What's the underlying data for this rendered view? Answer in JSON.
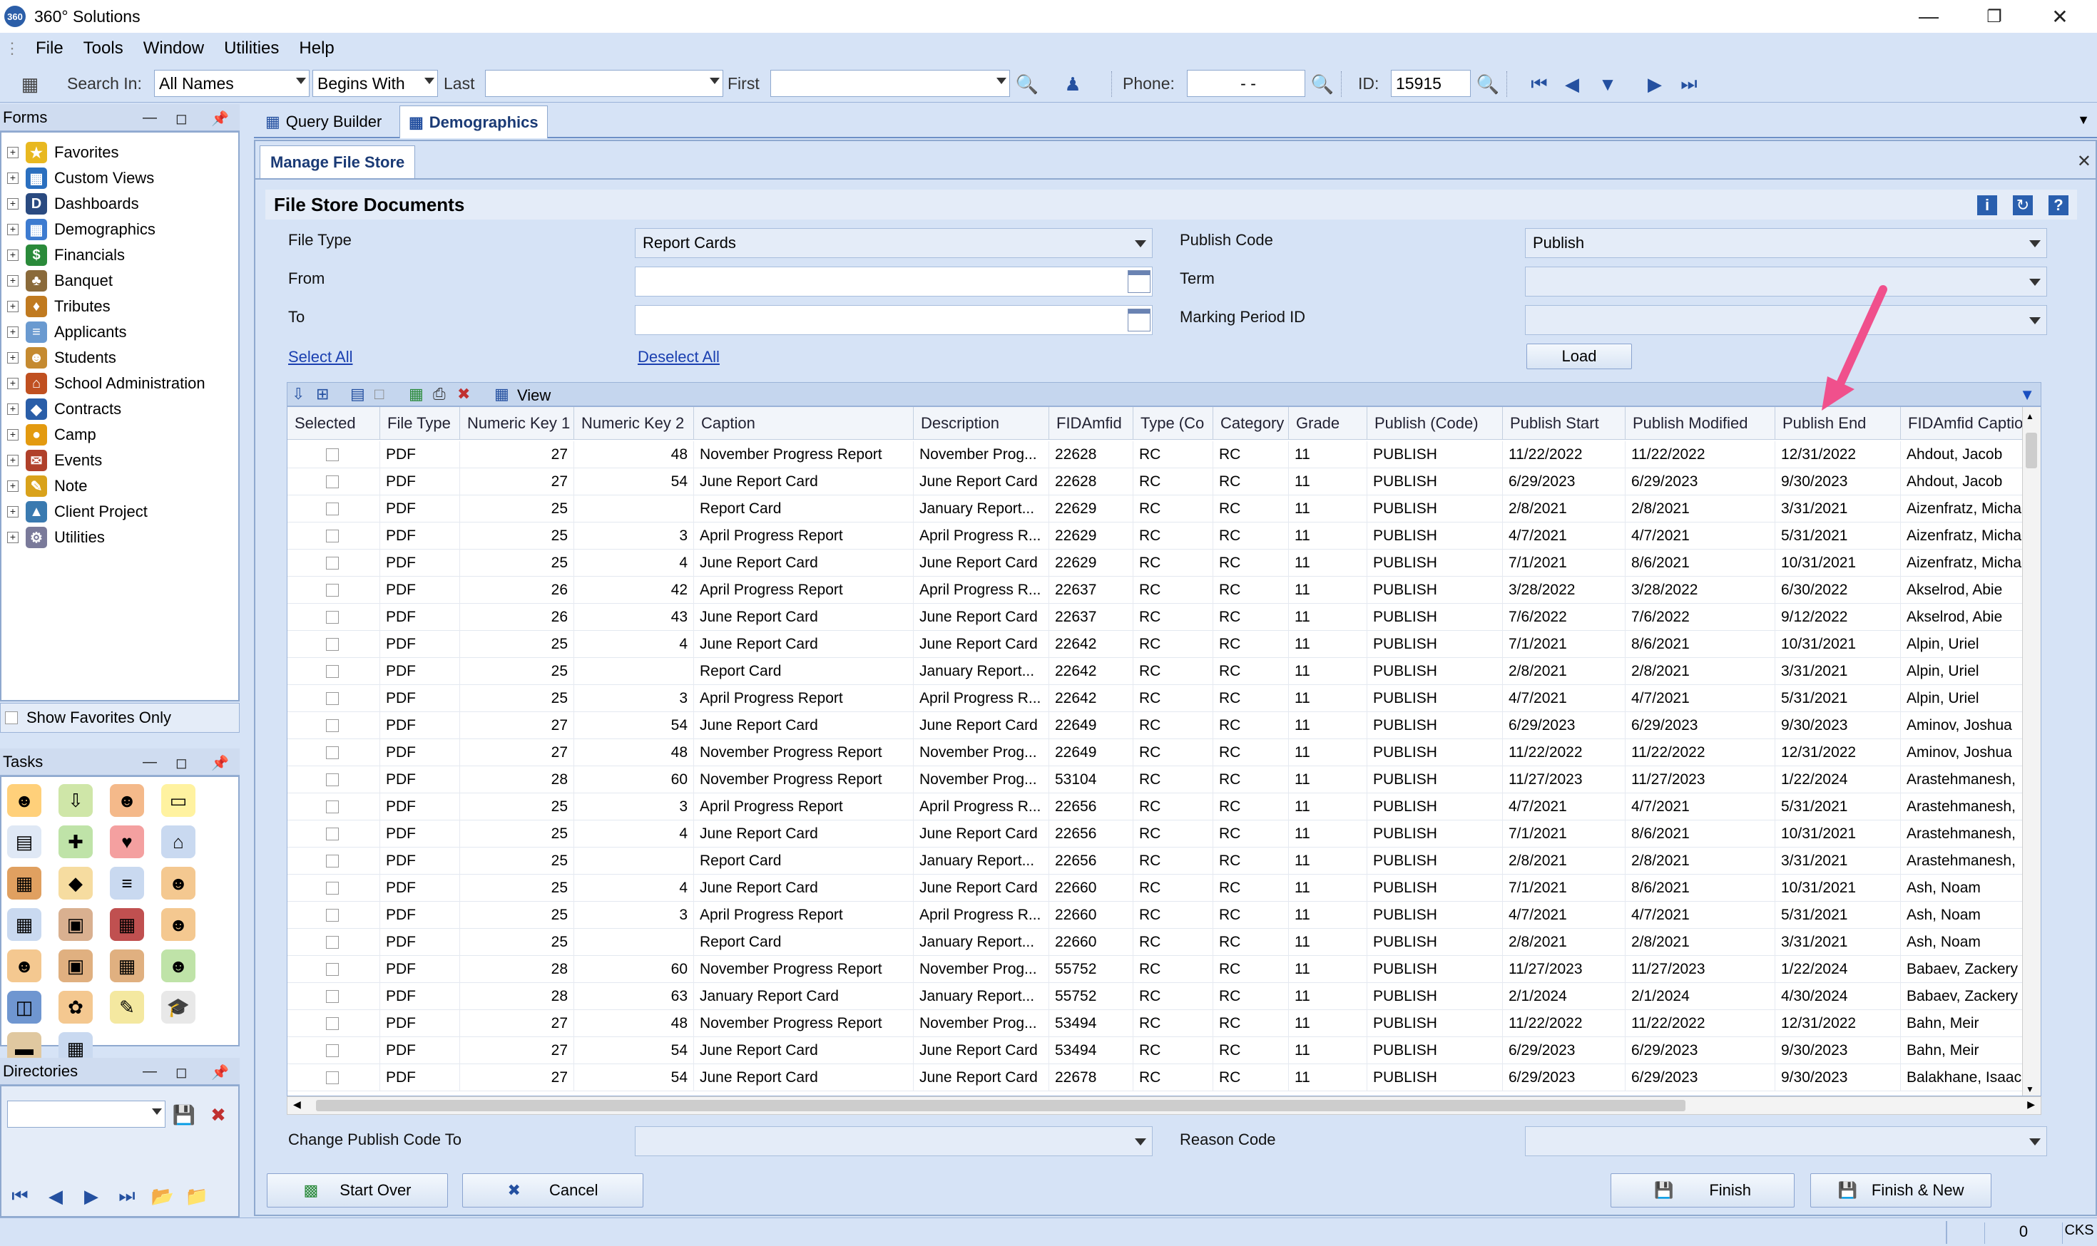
{
  "app": {
    "title": "360° Solutions",
    "logo_text": "360"
  },
  "menu": [
    "File",
    "Tools",
    "Window",
    "Utilities",
    "Help"
  ],
  "toolbar": {
    "search_in_label": "Search In:",
    "search_in_value": "All Names",
    "match_value": "Begins With",
    "last_label": "Last",
    "last_value": "",
    "first_label": "First",
    "first_value": "",
    "phone_label": "Phone:",
    "phone_value": "-   -",
    "id_label": "ID:",
    "id_value": "15915"
  },
  "forms_panel": {
    "title": "Forms",
    "items": [
      "Favorites",
      "Custom Views",
      "Dashboards",
      "Demographics",
      "Financials",
      "Banquet",
      "Tributes",
      "Applicants",
      "Students",
      "School Administration",
      "Contracts",
      "Camp",
      "Events",
      "Note",
      "Client Project",
      "Utilities"
    ],
    "show_favorites_label": "Show Favorites Only"
  },
  "tasks_panel": {
    "title": "Tasks"
  },
  "directories_panel": {
    "title": "Directories"
  },
  "tabs": [
    "Query Builder",
    "Demographics"
  ],
  "subtab": "Manage File Store",
  "section": {
    "title": "File Store Documents"
  },
  "form": {
    "file_type_label": "File Type",
    "file_type_value": "Report Cards",
    "from_label": "From",
    "from_value": "",
    "to_label": "To",
    "to_value": "",
    "publish_code_label": "Publish Code",
    "publish_code_value": "Publish",
    "term_label": "Term",
    "term_value": "",
    "marking_period_label": "Marking Period ID",
    "marking_period_value": "",
    "select_all": "Select All",
    "deselect_all": "Deselect All",
    "load": "Load",
    "view": "View"
  },
  "grid": {
    "columns": [
      "Selected",
      "File Type",
      "Numeric Key 1",
      "Numeric Key 2",
      "Caption",
      "Description",
      "FIDAmfid",
      "Type (Co",
      "Category",
      "Grade",
      "Publish (Code)",
      "Publish Start",
      "Publish Modified",
      "Publish End",
      "FIDAmfid Captio"
    ],
    "rows": [
      [
        "PDF",
        "27",
        "48",
        "November Progress Report",
        "November Prog...",
        "22628",
        "RC",
        "RC",
        "11",
        "PUBLISH",
        "11/22/2022",
        "11/22/2022",
        "12/31/2022",
        "Ahdout, Jacob"
      ],
      [
        "PDF",
        "27",
        "54",
        "June Report Card",
        "June Report Card",
        "22628",
        "RC",
        "RC",
        "11",
        "PUBLISH",
        "6/29/2023",
        "6/29/2023",
        "9/30/2023",
        "Ahdout, Jacob"
      ],
      [
        "PDF",
        "25",
        "",
        "Report Card",
        "January Report...",
        "22629",
        "RC",
        "RC",
        "11",
        "PUBLISH",
        "2/8/2021",
        "2/8/2021",
        "3/31/2021",
        "Aizenfratz, Micha"
      ],
      [
        "PDF",
        "25",
        "3",
        "April Progress Report",
        "April Progress R...",
        "22629",
        "RC",
        "RC",
        "11",
        "PUBLISH",
        "4/7/2021",
        "4/7/2021",
        "5/31/2021",
        "Aizenfratz, Micha"
      ],
      [
        "PDF",
        "25",
        "4",
        "June Report Card",
        "June Report Card",
        "22629",
        "RC",
        "RC",
        "11",
        "PUBLISH",
        "7/1/2021",
        "8/6/2021",
        "10/31/2021",
        "Aizenfratz, Micha"
      ],
      [
        "PDF",
        "26",
        "42",
        "April Progress Report",
        "April Progress R...",
        "22637",
        "RC",
        "RC",
        "11",
        "PUBLISH",
        "3/28/2022",
        "3/28/2022",
        "6/30/2022",
        "Akselrod, Abie"
      ],
      [
        "PDF",
        "26",
        "43",
        "June Report Card",
        "June Report Card",
        "22637",
        "RC",
        "RC",
        "11",
        "PUBLISH",
        "7/6/2022",
        "7/6/2022",
        "9/12/2022",
        "Akselrod, Abie"
      ],
      [
        "PDF",
        "25",
        "4",
        "June Report Card",
        "June Report Card",
        "22642",
        "RC",
        "RC",
        "11",
        "PUBLISH",
        "7/1/2021",
        "8/6/2021",
        "10/31/2021",
        "Alpin, Uriel"
      ],
      [
        "PDF",
        "25",
        "",
        "Report Card",
        "January Report...",
        "22642",
        "RC",
        "RC",
        "11",
        "PUBLISH",
        "2/8/2021",
        "2/8/2021",
        "3/31/2021",
        "Alpin, Uriel"
      ],
      [
        "PDF",
        "25",
        "3",
        "April Progress Report",
        "April Progress R...",
        "22642",
        "RC",
        "RC",
        "11",
        "PUBLISH",
        "4/7/2021",
        "4/7/2021",
        "5/31/2021",
        "Alpin, Uriel"
      ],
      [
        "PDF",
        "27",
        "54",
        "June Report Card",
        "June Report Card",
        "22649",
        "RC",
        "RC",
        "11",
        "PUBLISH",
        "6/29/2023",
        "6/29/2023",
        "9/30/2023",
        "Aminov, Joshua"
      ],
      [
        "PDF",
        "27",
        "48",
        "November Progress Report",
        "November Prog...",
        "22649",
        "RC",
        "RC",
        "11",
        "PUBLISH",
        "11/22/2022",
        "11/22/2022",
        "12/31/2022",
        "Aminov, Joshua"
      ],
      [
        "PDF",
        "28",
        "60",
        "November Progress Report",
        "November Prog...",
        "53104",
        "RC",
        "RC",
        "11",
        "PUBLISH",
        "11/27/2023",
        "11/27/2023",
        "1/22/2024",
        "Arastehmanesh,"
      ],
      [
        "PDF",
        "25",
        "3",
        "April Progress Report",
        "April Progress R...",
        "22656",
        "RC",
        "RC",
        "11",
        "PUBLISH",
        "4/7/2021",
        "4/7/2021",
        "5/31/2021",
        "Arastehmanesh,"
      ],
      [
        "PDF",
        "25",
        "4",
        "June Report Card",
        "June Report Card",
        "22656",
        "RC",
        "RC",
        "11",
        "PUBLISH",
        "7/1/2021",
        "8/6/2021",
        "10/31/2021",
        "Arastehmanesh,"
      ],
      [
        "PDF",
        "25",
        "",
        "Report Card",
        "January Report...",
        "22656",
        "RC",
        "RC",
        "11",
        "PUBLISH",
        "2/8/2021",
        "2/8/2021",
        "3/31/2021",
        "Arastehmanesh,"
      ],
      [
        "PDF",
        "25",
        "4",
        "June Report Card",
        "June Report Card",
        "22660",
        "RC",
        "RC",
        "11",
        "PUBLISH",
        "7/1/2021",
        "8/6/2021",
        "10/31/2021",
        "Ash, Noam"
      ],
      [
        "PDF",
        "25",
        "3",
        "April Progress Report",
        "April Progress R...",
        "22660",
        "RC",
        "RC",
        "11",
        "PUBLISH",
        "4/7/2021",
        "4/7/2021",
        "5/31/2021",
        "Ash, Noam"
      ],
      [
        "PDF",
        "25",
        "",
        "Report Card",
        "January Report...",
        "22660",
        "RC",
        "RC",
        "11",
        "PUBLISH",
        "2/8/2021",
        "2/8/2021",
        "3/31/2021",
        "Ash, Noam"
      ],
      [
        "PDF",
        "28",
        "60",
        "November Progress Report",
        "November Prog...",
        "55752",
        "RC",
        "RC",
        "11",
        "PUBLISH",
        "11/27/2023",
        "11/27/2023",
        "1/22/2024",
        "Babaev, Zackery"
      ],
      [
        "PDF",
        "28",
        "63",
        "January Report Card",
        "January Report...",
        "55752",
        "RC",
        "RC",
        "11",
        "PUBLISH",
        "2/1/2024",
        "2/1/2024",
        "4/30/2024",
        "Babaev, Zackery"
      ],
      [
        "PDF",
        "27",
        "48",
        "November Progress Report",
        "November Prog...",
        "53494",
        "RC",
        "RC",
        "11",
        "PUBLISH",
        "11/22/2022",
        "11/22/2022",
        "12/31/2022",
        "Bahn, Meir"
      ],
      [
        "PDF",
        "27",
        "54",
        "June Report Card",
        "June Report Card",
        "53494",
        "RC",
        "RC",
        "11",
        "PUBLISH",
        "6/29/2023",
        "6/29/2023",
        "9/30/2023",
        "Bahn, Meir"
      ],
      [
        "PDF",
        "27",
        "54",
        "June Report Card",
        "June Report Card",
        "22678",
        "RC",
        "RC",
        "11",
        "PUBLISH",
        "6/29/2023",
        "6/29/2023",
        "9/30/2023",
        "Balakhane, Isaac"
      ]
    ]
  },
  "bottom": {
    "change_publish_label": "Change Publish Code To",
    "change_publish_value": "",
    "reason_code_label": "Reason Code",
    "reason_code_value": "",
    "start_over": "Start Over",
    "cancel": "Cancel",
    "finish": "Finish",
    "finish_new": "Finish & New"
  },
  "status": {
    "count": "0",
    "caps": "CKS"
  },
  "colors": {
    "accent": "#1a3fb0",
    "panel": "#d6e3f6",
    "annotation_arrow": "#f0508c"
  }
}
